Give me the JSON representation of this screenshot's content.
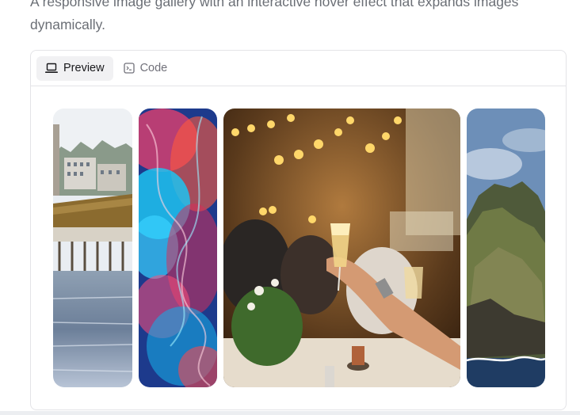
{
  "description": "A responsive image gallery with an interactive hover effect that expands images dynamically.",
  "tabs": {
    "preview": {
      "label": "Preview",
      "icon": "laptop-icon"
    },
    "code": {
      "label": "Code",
      "icon": "terminal-icon"
    }
  },
  "gallery": {
    "images": [
      {
        "subject": "lucerne-bridge",
        "expanded": false
      },
      {
        "subject": "colorful-smoke",
        "expanded": false
      },
      {
        "subject": "celebration-toast",
        "expanded": true
      },
      {
        "subject": "coastal-cliff",
        "expanded": false
      }
    ]
  }
}
